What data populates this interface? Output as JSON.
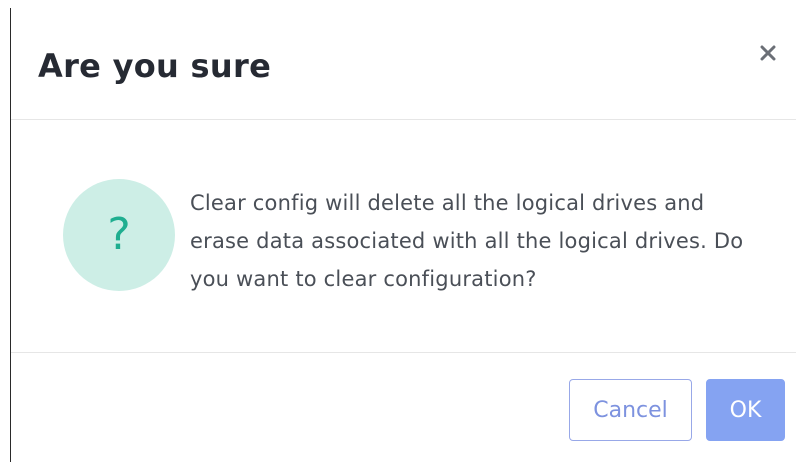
{
  "dialog": {
    "title": "Are you sure",
    "close_icon": "close-icon",
    "icon": "question-icon",
    "icon_glyph": "?",
    "message": "Clear config will delete all the logical drives and erase data associated with all the logical drives. Do you want to clear configuration?",
    "cancel_label": "Cancel",
    "ok_label": "OK"
  },
  "colors": {
    "title_text": "#262a33",
    "body_text": "#4a4f57",
    "icon_bg": "#cdeee6",
    "icon_fg": "#1fae90",
    "cancel_border": "#98a8e8",
    "cancel_text": "#7d92df",
    "ok_bg": "#85a3f2",
    "ok_text": "#ffffff"
  }
}
